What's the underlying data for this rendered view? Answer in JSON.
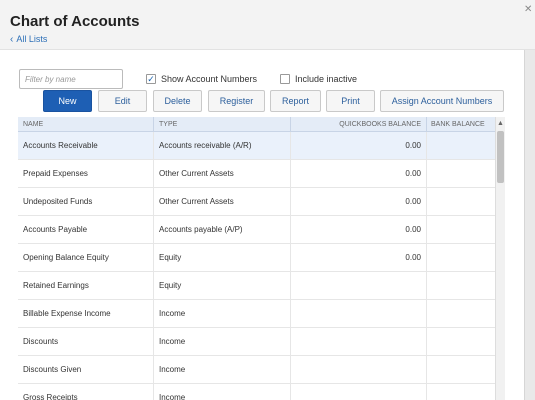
{
  "page": {
    "title": "Chart of Accounts",
    "back_label": "All Lists"
  },
  "toolbar": {
    "filter_placeholder": "Filter by name",
    "show_account_numbers_label": "Show Account Numbers",
    "show_account_numbers_checked": true,
    "include_inactive_label": "Include inactive",
    "include_inactive_checked": false,
    "buttons": {
      "new": "New",
      "edit": "Edit",
      "delete": "Delete",
      "register": "Register",
      "report": "Report",
      "print": "Print",
      "assign": "Assign Account Numbers"
    }
  },
  "table": {
    "columns": {
      "name": "NAME",
      "type": "TYPE",
      "qb_balance": "QUICKBOOKS BALANCE",
      "bank_balance": "BANK BALANCE"
    },
    "rows": [
      {
        "name": "Accounts Receivable",
        "type": "Accounts receivable (A/R)",
        "qb_balance": "0.00",
        "bank_balance": ""
      },
      {
        "name": "Prepaid Expenses",
        "type": "Other Current Assets",
        "qb_balance": "0.00",
        "bank_balance": ""
      },
      {
        "name": "Undeposited Funds",
        "type": "Other Current Assets",
        "qb_balance": "0.00",
        "bank_balance": ""
      },
      {
        "name": "Accounts Payable",
        "type": "Accounts payable (A/P)",
        "qb_balance": "0.00",
        "bank_balance": ""
      },
      {
        "name": "Opening Balance Equity",
        "type": "Equity",
        "qb_balance": "0.00",
        "bank_balance": ""
      },
      {
        "name": "Retained Earnings",
        "type": "Equity",
        "qb_balance": "",
        "bank_balance": ""
      },
      {
        "name": "Billable Expense Income",
        "type": "Income",
        "qb_balance": "",
        "bank_balance": ""
      },
      {
        "name": "Discounts",
        "type": "Income",
        "qb_balance": "",
        "bank_balance": ""
      },
      {
        "name": "Discounts Given",
        "type": "Income",
        "qb_balance": "",
        "bank_balance": ""
      },
      {
        "name": "Gross Receipts",
        "type": "Income",
        "qb_balance": "",
        "bank_balance": ""
      }
    ]
  },
  "colors": {
    "primary": "#1e5fb4",
    "link": "#2c6fb7",
    "header_bg": "#e4ecf7",
    "selected_row": "#eaf1fb"
  }
}
